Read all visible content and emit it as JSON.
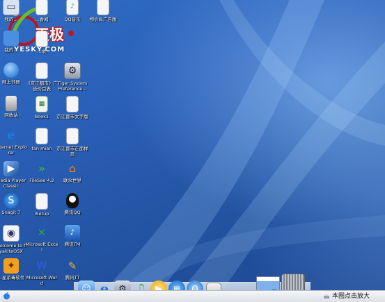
{
  "logo": {
    "text_main": "天极",
    "text_sub": "YESKY.COM"
  },
  "desktop_icons": [
    {
      "name": "desktop-icon-1",
      "label": "我的...",
      "icon": "computer-icon"
    },
    {
      "name": "desktop-icon-2",
      "label": "...香闻",
      "icon": "document-icon"
    },
    {
      "name": "desktop-icon-3",
      "label": "QQ音乐",
      "icon": "music-icon"
    },
    {
      "name": "desktop-icon-4",
      "label": "物价局广告版",
      "icon": "document-icon"
    },
    {
      "name": "desktop-icon-5",
      "label": "我的...",
      "icon": "folder-icon"
    },
    {
      "name": "desktop-icon-6",
      "label": "...收",
      "icon": "document-icon"
    },
    {
      "name": "desktop-icon-7",
      "label": "网上邻居",
      "icon": "network-icon"
    },
    {
      "name": "desktop-icon-8",
      "label": "《京江都市》广告价目表",
      "icon": "document-icon"
    },
    {
      "name": "desktop-icon-9",
      "label": "Tiger System Preference...",
      "icon": "settings-icon"
    },
    {
      "name": "desktop-icon-10",
      "label": "回收站",
      "icon": "trash-icon"
    },
    {
      "name": "desktop-icon-11",
      "label": "Book1",
      "icon": "spreadsheet-icon"
    },
    {
      "name": "desktop-icon-12",
      "label": "京江都市文字版",
      "icon": "document-icon"
    },
    {
      "name": "desktop-icon-13",
      "label": "Internet Explorer",
      "icon": "ie-icon"
    },
    {
      "name": "desktop-icon-14",
      "label": "fan mian",
      "icon": "document-icon"
    },
    {
      "name": "desktop-icon-15",
      "label": "京江都市正面样页",
      "icon": "document-icon"
    },
    {
      "name": "desktop-icon-16",
      "label": "Media Player Classic",
      "icon": "media-player-icon"
    },
    {
      "name": "desktop-icon-17",
      "label": "FileSee 4.2",
      "icon": "filesee-icon"
    },
    {
      "name": "desktop-icon-18",
      "label": "联众世界",
      "icon": "house-icon"
    },
    {
      "name": "desktop-icon-19",
      "label": "Snagit 7",
      "icon": "snagit-icon"
    },
    {
      "name": "desktop-icon-20",
      "label": "iSetup",
      "icon": "document-icon"
    },
    {
      "name": "desktop-icon-21",
      "label": "腾讯QQ",
      "icon": "qq-icon"
    },
    {
      "name": "desktop-icon-22",
      "label": "Welcome to flyakiteOSX",
      "icon": "welcome-icon"
    },
    {
      "name": "desktop-icon-23",
      "label": "Microsoft Excel",
      "icon": "excel-icon"
    },
    {
      "name": "desktop-icon-24",
      "label": "腾讯TM",
      "icon": "tm-icon"
    },
    {
      "name": "desktop-icon-25",
      "label": "...星杀毒软件",
      "icon": "antivirus-icon"
    },
    {
      "name": "desktop-icon-26",
      "label": "Microsoft Word",
      "icon": "word-icon"
    },
    {
      "name": "desktop-icon-27",
      "label": "腾讯TT",
      "icon": "tt-icon"
    }
  ],
  "dock": {
    "items": [
      {
        "name": "dock-finder-icon"
      },
      {
        "name": "dock-ie-icon"
      },
      {
        "name": "dock-system-prefs-icon"
      },
      {
        "name": "dock-music-icon"
      },
      {
        "name": "dock-media-play-icon"
      },
      {
        "name": "dock-filmstrip-icon"
      },
      {
        "name": "dock-quicktime-icon"
      },
      {
        "name": "dock-apple-icon"
      },
      {
        "name": "dock-window-thumbnail-icon"
      },
      {
        "name": "dock-globe-icon"
      },
      {
        "name": "dock-trash-icon"
      }
    ]
  },
  "taskbar": {
    "caption": "本图点击放大"
  },
  "colors": {
    "desktop_blue": "#2a5fb8",
    "logo_red": "#c0141a",
    "logo_green": "#6dbb2a"
  }
}
